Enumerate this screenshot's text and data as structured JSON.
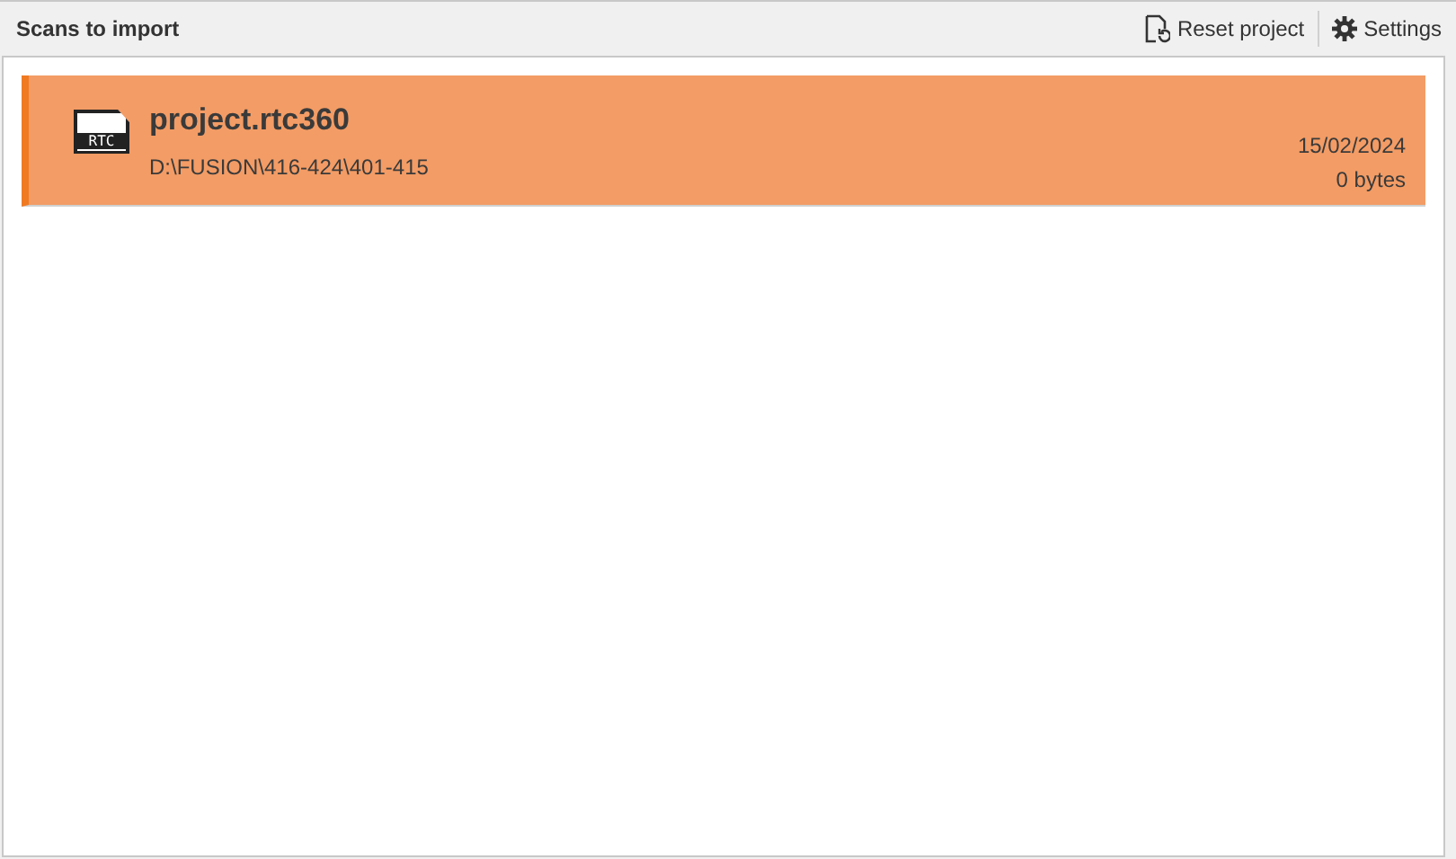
{
  "header": {
    "title": "Scans to import",
    "actions": [
      {
        "kind": "reset",
        "label": "Reset project"
      },
      {
        "kind": "settings",
        "label": "Settings"
      }
    ]
  },
  "scans": [
    {
      "name": "project.rtc360",
      "icon_label": "RTC",
      "path": "D:\\FUSION\\416-424\\401-415",
      "date": "15/02/2024",
      "size": "0 bytes",
      "selected": true
    }
  ]
}
